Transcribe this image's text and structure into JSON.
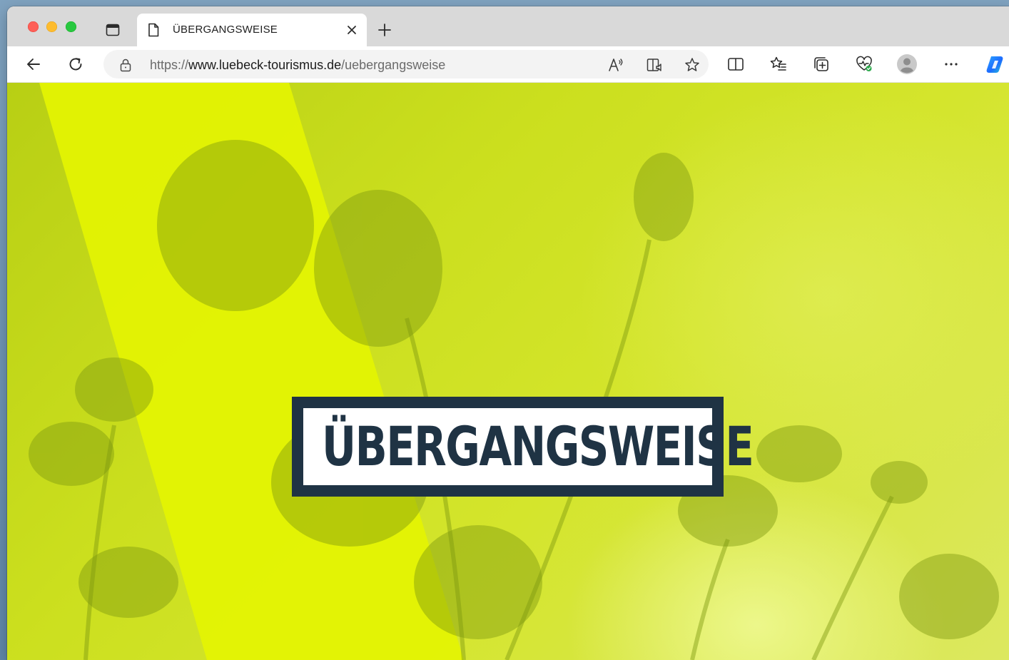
{
  "browser": {
    "tab": {
      "title": "ÜBERGANGSWEISE"
    },
    "address": {
      "scheme": "https://",
      "host": "www.luebeck-tourismus.de",
      "path": "/uebergangsweise"
    },
    "icons": {
      "back": "back-arrow-icon",
      "reload": "reload-icon",
      "lock": "lock-icon",
      "read_aloud": "read-aloud-icon",
      "immersive_reader": "immersive-reader-icon",
      "favorite": "star-icon",
      "split_screen": "split-screen-icon",
      "favorites": "favorites-list-icon",
      "collections": "collections-icon",
      "browser_essentials": "browser-essentials-icon",
      "profile": "profile-avatar-icon",
      "more": "more-icon",
      "copilot": "copilot-icon"
    },
    "colors": {
      "close": "#fe5f57",
      "minimize": "#febc2e",
      "maximize": "#28c840"
    }
  },
  "page": {
    "logo_text": "ÜBERGANGSWEISE",
    "colors": {
      "logo": "#1f3344",
      "background": "#cbdf1e",
      "stripe": "#e4f402"
    }
  }
}
